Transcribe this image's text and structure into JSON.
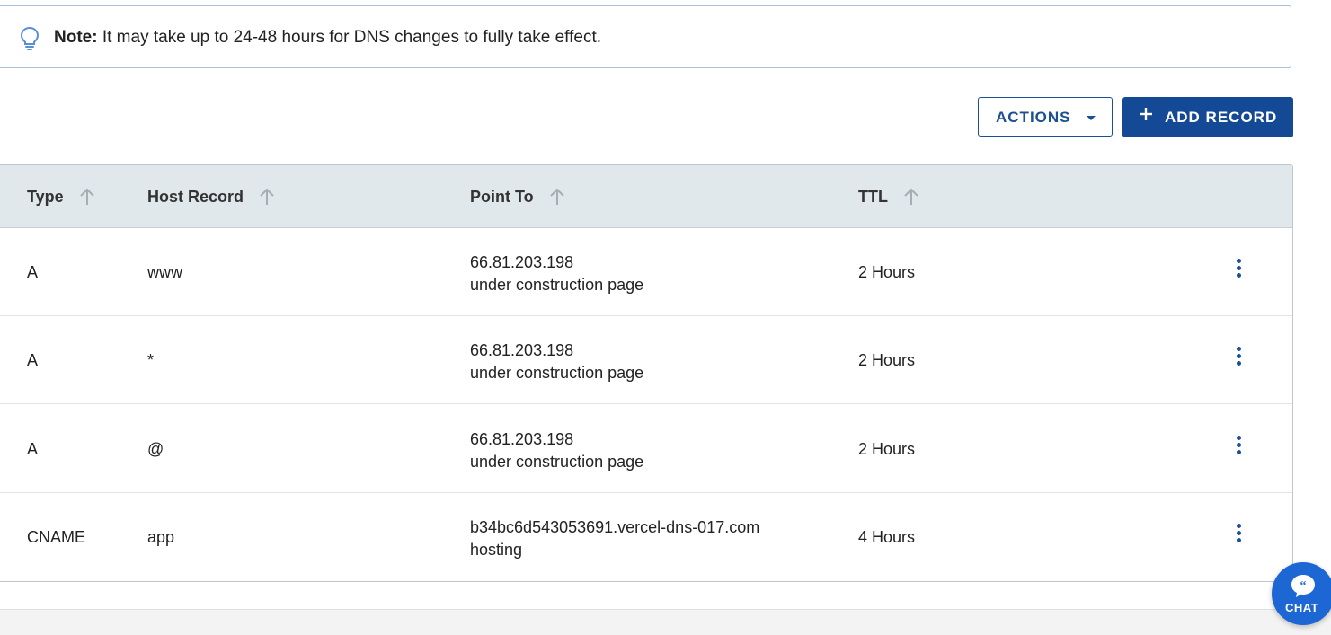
{
  "note": {
    "label": "Note:",
    "text": " It may take up to 24-48 hours for DNS changes to fully take effect.",
    "icon": "lightbulb-icon"
  },
  "toolbar": {
    "actions_label": "ACTIONS",
    "add_record_label": "ADD RECORD"
  },
  "table": {
    "columns": [
      {
        "label": "Type"
      },
      {
        "label": "Host Record"
      },
      {
        "label": "Point To"
      },
      {
        "label": "TTL"
      }
    ],
    "rows": [
      {
        "type": "A",
        "host": "www",
        "point_to": "66.81.203.198",
        "point_to_note": "under construction page",
        "ttl": "2 Hours"
      },
      {
        "type": "A",
        "host": "*",
        "point_to": "66.81.203.198",
        "point_to_note": "under construction page",
        "ttl": "2 Hours"
      },
      {
        "type": "A",
        "host": "@",
        "point_to": "66.81.203.198",
        "point_to_note": "under construction page",
        "ttl": "2 Hours"
      },
      {
        "type": "CNAME",
        "host": "app",
        "point_to": "b34bc6d543053691.vercel-dns-017.com",
        "point_to_note": "hosting",
        "ttl": "4 Hours"
      }
    ]
  },
  "chat": {
    "label": "CHAT"
  },
  "colors": {
    "primary": "#144a95",
    "header_bg": "#e1e8ec",
    "chat": "#1c67d4"
  }
}
